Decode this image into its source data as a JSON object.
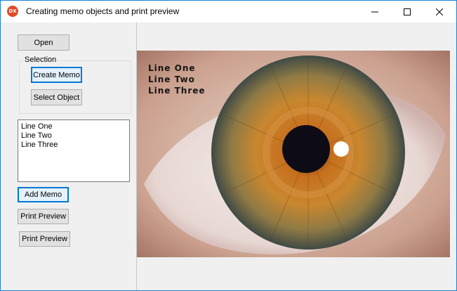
{
  "window": {
    "title": "Creating memo objects and print preview",
    "app_icon": "DX"
  },
  "buttons": {
    "open": "Open",
    "create_memo": "Create Memo",
    "select_object": "Select Object",
    "add_memo": "Add Memo",
    "print_preview_1": "Print Preview",
    "print_preview_2": "Print Preview"
  },
  "selection_group": {
    "label": "Selection"
  },
  "memo": {
    "lines": [
      "Line One",
      "Line Two",
      "Line Three"
    ]
  },
  "image": {
    "overlay_lines": [
      "Line One",
      "Line Two",
      "Line Three"
    ]
  },
  "colors": {
    "accent": "#0078d7",
    "title_border": "#1883d7",
    "icon": "#e14a28"
  }
}
